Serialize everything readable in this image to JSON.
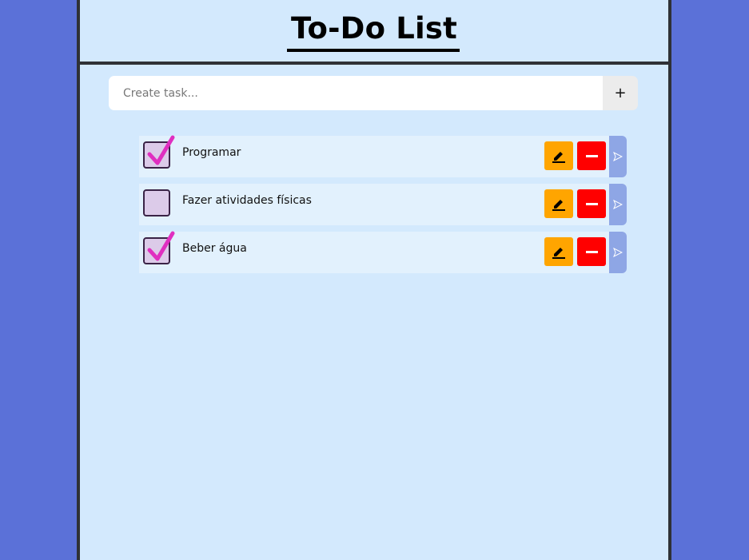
{
  "header": {
    "title": "To-Do List"
  },
  "create": {
    "placeholder": "Create task...",
    "add_label": "+"
  },
  "tasks": [
    {
      "text": "Programar",
      "done": true
    },
    {
      "text": "Fazer atividades físicas",
      "done": false
    },
    {
      "text": "Beber água",
      "done": true
    }
  ],
  "colors": {
    "background": "#5b71d8",
    "panel": "#d3e9fd",
    "task_bg": "#e2f1fd",
    "edit": "#ffa500",
    "delete": "#ff0000",
    "send": "#8ea6e5",
    "checkmark": "#e02fc0"
  },
  "icons": {
    "edit": "pencil-icon",
    "delete": "minus-icon",
    "send": "send-icon",
    "check": "checkmark-icon"
  }
}
